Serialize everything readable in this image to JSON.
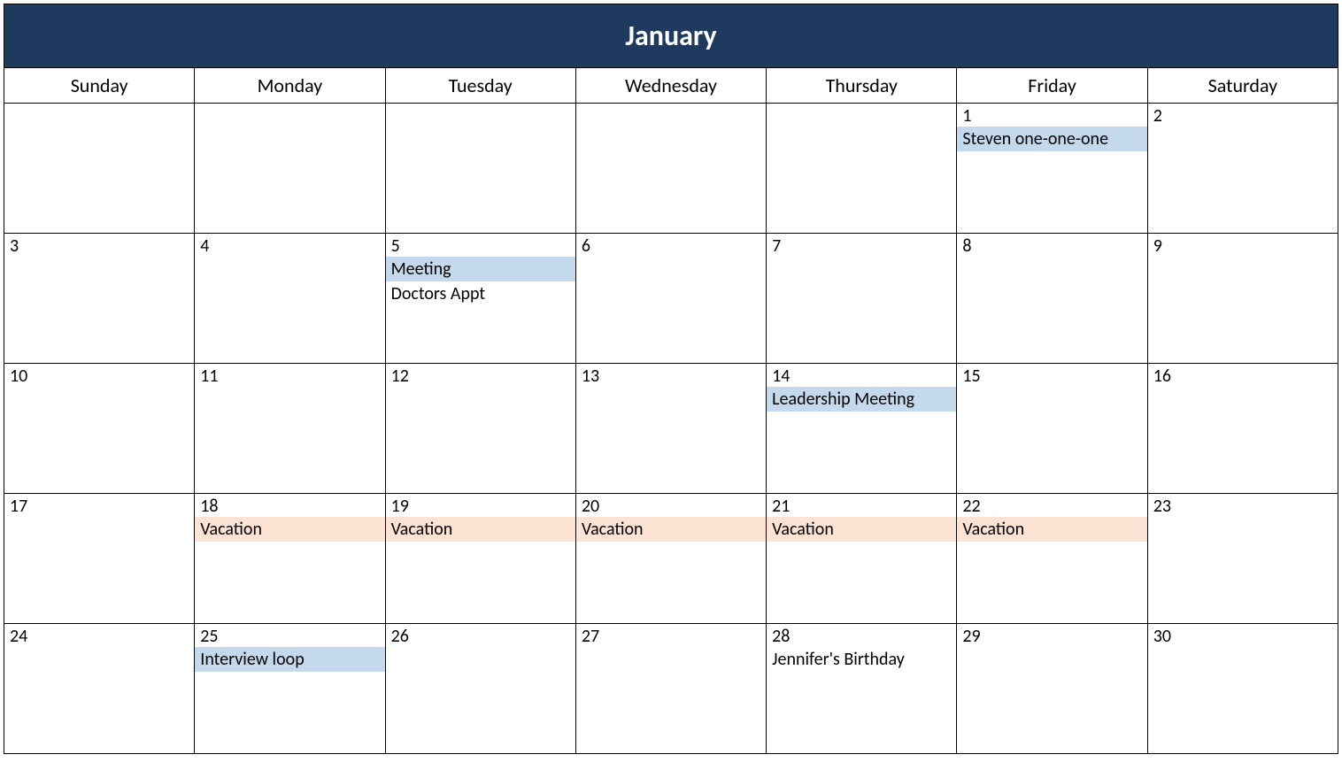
{
  "month_title": "January",
  "day_headers": [
    "Sunday",
    "Monday",
    "Tuesday",
    "Wednesday",
    "Thursday",
    "Friday",
    "Saturday"
  ],
  "event_colors": {
    "blue": "#c5d9ed",
    "peach": "#fce3d3"
  },
  "weeks": [
    [
      {
        "date": null,
        "events": []
      },
      {
        "date": null,
        "events": []
      },
      {
        "date": null,
        "events": []
      },
      {
        "date": null,
        "events": []
      },
      {
        "date": null,
        "events": []
      },
      {
        "date": "1",
        "events": [
          {
            "label": "Steven one-one-one",
            "style": "blue"
          }
        ]
      },
      {
        "date": "2",
        "events": []
      }
    ],
    [
      {
        "date": "3",
        "events": []
      },
      {
        "date": "4",
        "events": []
      },
      {
        "date": "5",
        "events": [
          {
            "label": "Meeting",
            "style": "blue"
          },
          {
            "label": "Doctors Appt",
            "style": "plain"
          }
        ]
      },
      {
        "date": "6",
        "events": []
      },
      {
        "date": "7",
        "events": []
      },
      {
        "date": "8",
        "events": []
      },
      {
        "date": "9",
        "events": []
      }
    ],
    [
      {
        "date": "10",
        "events": []
      },
      {
        "date": "11",
        "events": []
      },
      {
        "date": "12",
        "events": []
      },
      {
        "date": "13",
        "events": []
      },
      {
        "date": "14",
        "events": [
          {
            "label": "Leadership Meeting",
            "style": "blue"
          }
        ]
      },
      {
        "date": "15",
        "events": []
      },
      {
        "date": "16",
        "events": []
      }
    ],
    [
      {
        "date": "17",
        "events": []
      },
      {
        "date": "18",
        "events": [
          {
            "label": "Vacation",
            "style": "peach"
          }
        ]
      },
      {
        "date": "19",
        "events": [
          {
            "label": "Vacation",
            "style": "peach"
          }
        ]
      },
      {
        "date": "20",
        "events": [
          {
            "label": "Vacation",
            "style": "peach"
          }
        ]
      },
      {
        "date": "21",
        "events": [
          {
            "label": "Vacation",
            "style": "peach"
          }
        ]
      },
      {
        "date": "22",
        "events": [
          {
            "label": "Vacation",
            "style": "peach"
          }
        ]
      },
      {
        "date": "23",
        "events": []
      }
    ],
    [
      {
        "date": "24",
        "events": []
      },
      {
        "date": "25",
        "events": [
          {
            "label": "Interview loop",
            "style": "blue"
          }
        ]
      },
      {
        "date": "26",
        "events": []
      },
      {
        "date": "27",
        "events": []
      },
      {
        "date": "28",
        "events": [
          {
            "label": "Jennifer's Birthday",
            "style": "plain"
          }
        ]
      },
      {
        "date": "29",
        "events": []
      },
      {
        "date": "30",
        "events": []
      }
    ]
  ]
}
